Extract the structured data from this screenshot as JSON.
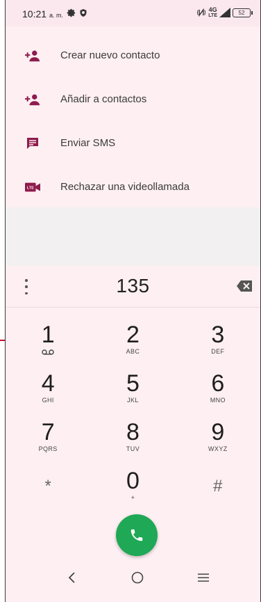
{
  "status_bar": {
    "time": "10:21",
    "ampm": "a. m.",
    "network": "4G",
    "network_sub": "LTE",
    "battery": "52",
    "icons": [
      "settings-gear-icon",
      "shield-icon",
      "nfc-icon",
      "signal-icon",
      "battery-icon"
    ]
  },
  "menu": {
    "items": [
      {
        "label": "Crear nuevo contacto",
        "icon": "add-person-icon"
      },
      {
        "label": "Añadir a contactos",
        "icon": "add-person-icon"
      },
      {
        "label": "Enviar SMS",
        "icon": "message-icon"
      },
      {
        "label": "Rechazar una videollamada",
        "icon": "lte-video-icon"
      }
    ]
  },
  "dialer": {
    "number": "135",
    "more_icon": "more-vert-icon",
    "backspace_icon": "backspace-icon"
  },
  "keypad": {
    "keys": [
      {
        "digit": "1",
        "letters": "",
        "extra": "voicemail-icon"
      },
      {
        "digit": "2",
        "letters": "ABC"
      },
      {
        "digit": "3",
        "letters": "DEF"
      },
      {
        "digit": "4",
        "letters": "GHI"
      },
      {
        "digit": "5",
        "letters": "JKL"
      },
      {
        "digit": "6",
        "letters": "MNO"
      },
      {
        "digit": "7",
        "letters": "PQRS"
      },
      {
        "digit": "8",
        "letters": "TUV"
      },
      {
        "digit": "9",
        "letters": "WXYZ"
      },
      {
        "digit": "*",
        "letters": ""
      },
      {
        "digit": "0",
        "letters": "+"
      },
      {
        "digit": "#",
        "letters": ""
      }
    ]
  },
  "call_button": {
    "icon": "phone-icon",
    "color": "#1fa855"
  },
  "nav": {
    "back": "back-chevron-icon",
    "home": "home-circle-icon",
    "recents": "menu-lines-icon"
  },
  "colors": {
    "accent": "#8e1b4d",
    "background": "#fdeff2",
    "call": "#1fa855"
  }
}
